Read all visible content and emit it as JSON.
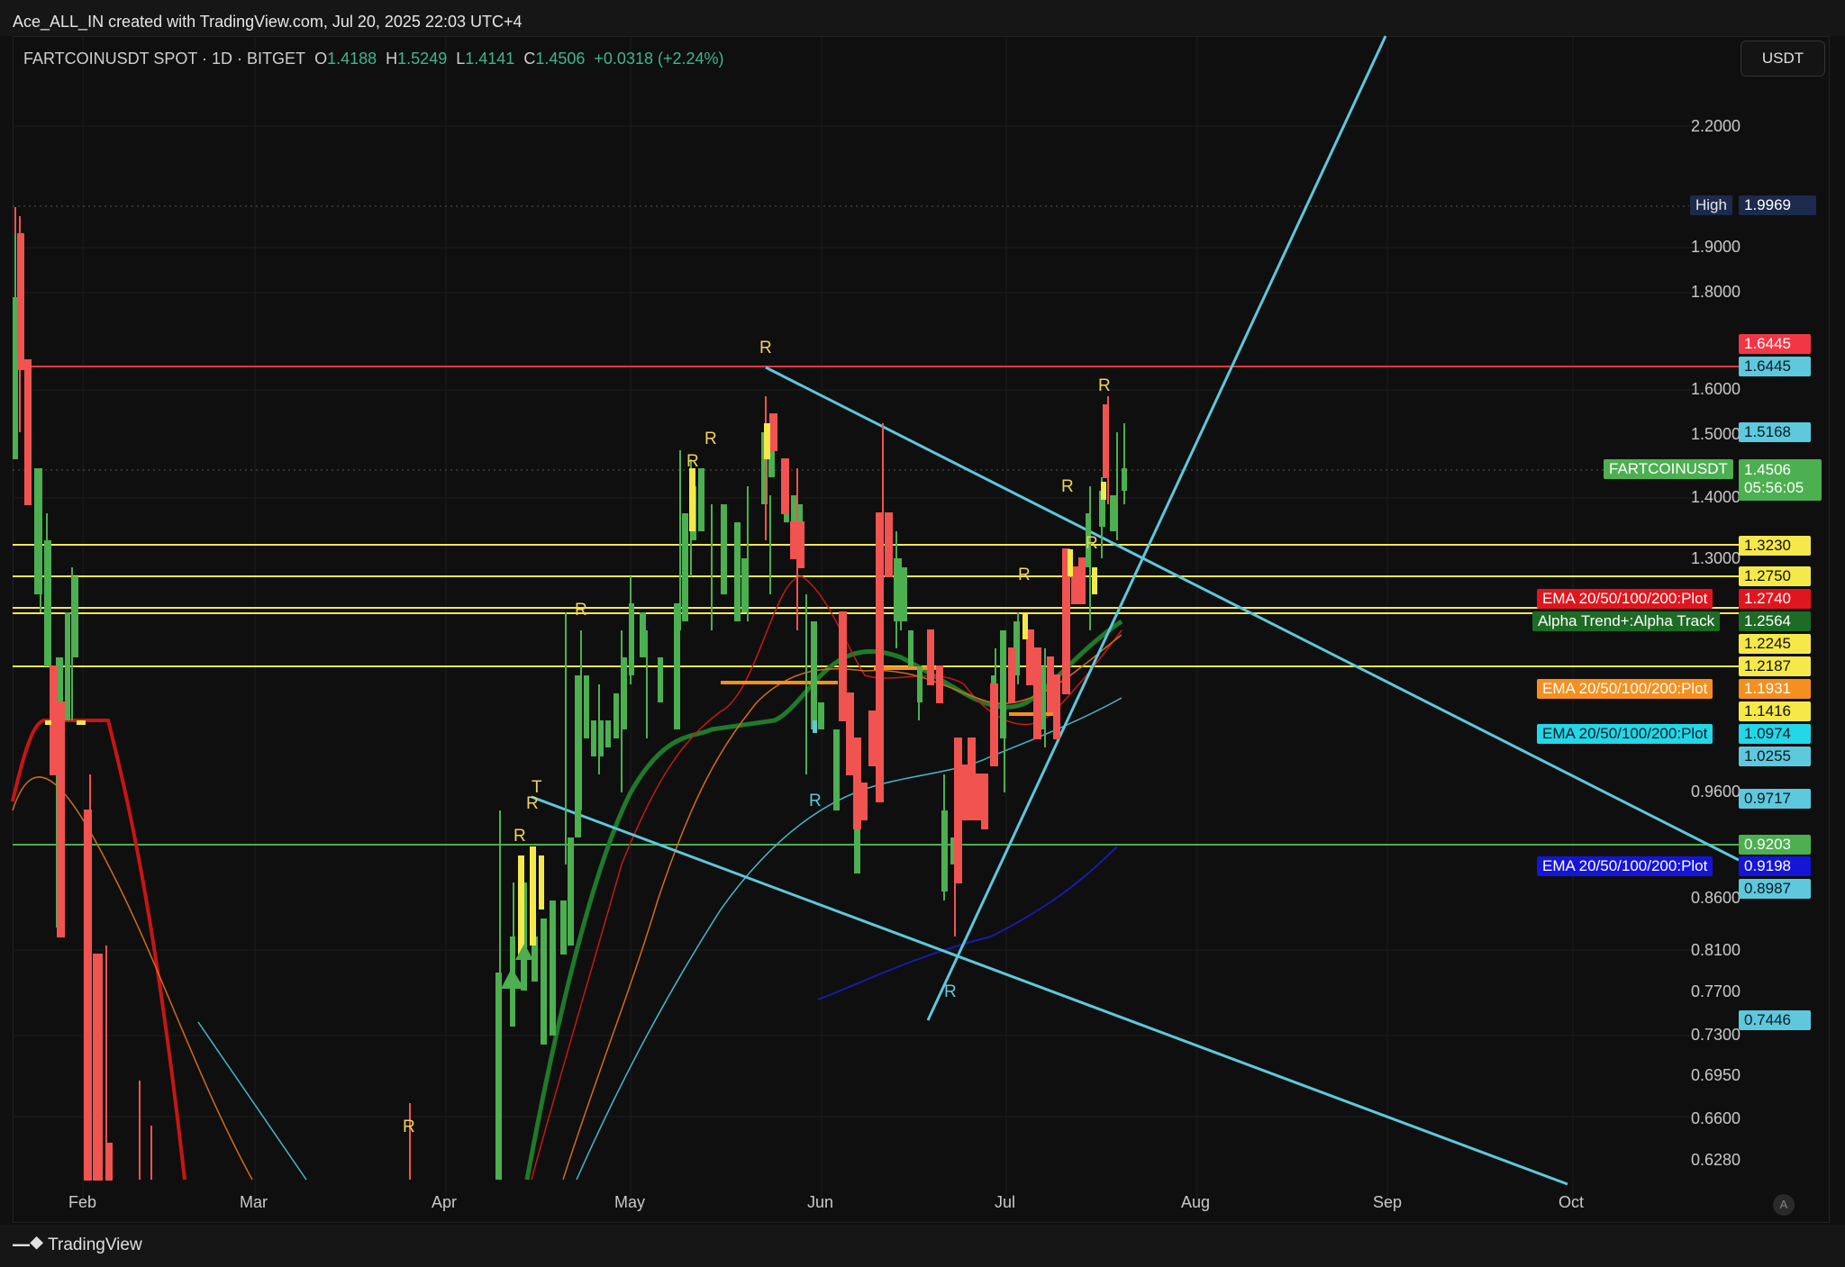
{
  "header": {
    "credit": "Ace_ALL_IN created with TradingView.com, Jul 20, 2025 22:03 UTC+4"
  },
  "legend": {
    "symbol": "FARTCOINUSDT SPOT · 1D · BITGET",
    "o_label": "O",
    "o_value": "1.4188",
    "h_label": "H",
    "h_value": "1.5249",
    "l_label": "L",
    "l_value": "1.4141",
    "c_label": "C",
    "c_value": "1.4506",
    "change": "+0.0318 (+2.24%)"
  },
  "currency_button": "USDT",
  "y_axis_ticks": [
    "2.2000",
    "1.9000",
    "1.8000",
    "1.6000",
    "1.5000",
    "1.4000",
    "1.3000",
    "0.9600",
    "0.8600",
    "0.8100",
    "0.7700",
    "0.7300",
    "0.6950",
    "0.6600",
    "0.6280"
  ],
  "x_axis_ticks": [
    "Feb",
    "Mar",
    "Apr",
    "May",
    "Jun",
    "Jul",
    "Aug",
    "Sep",
    "Oct"
  ],
  "price_tags": {
    "high_label": "High",
    "high_value": "1.9969",
    "resistance_red": "1.6445",
    "resistance_teal": "1.6445",
    "t_15168": "1.5168",
    "symbol_label": "FARTCOINUSDT",
    "last_price": "1.4506",
    "countdown": "05:56:05",
    "y_13230": "1.3230",
    "y_12750": "1.2750",
    "ema_red_label": "EMA 20/50/100/200:Plot",
    "ema_red_value": "1.2740",
    "alpha_label": "Alpha Trend+:Alpha Track",
    "alpha_value": "1.2564",
    "y_12245": "1.2245",
    "y_12187": "1.2187",
    "ema_orange_label": "EMA 20/50/100/200:Plot",
    "ema_orange_value": "1.1931",
    "y_11416": "1.1416",
    "ema_cyan_label": "EMA 20/50/100/200:Plot",
    "ema_cyan_value": "1.0974",
    "t_10255": "1.0255",
    "t_09717": "0.9717",
    "g_09203": "0.9203",
    "ema_blue_label": "EMA 20/50/100/200:Plot",
    "ema_blue_value": "0.9198",
    "t_08987": "0.8987",
    "t_07446": "0.7446"
  },
  "markers": {
    "r": "R",
    "t": "T"
  },
  "auto_button": "A",
  "footer": {
    "brand": "TradingView"
  },
  "colors": {
    "bull": "#4caf50",
    "bear": "#f05350",
    "yellow": "#f5e94a",
    "teal": "#5ec8dd",
    "resistance": "#f23645",
    "support_green": "#4caf50"
  }
}
